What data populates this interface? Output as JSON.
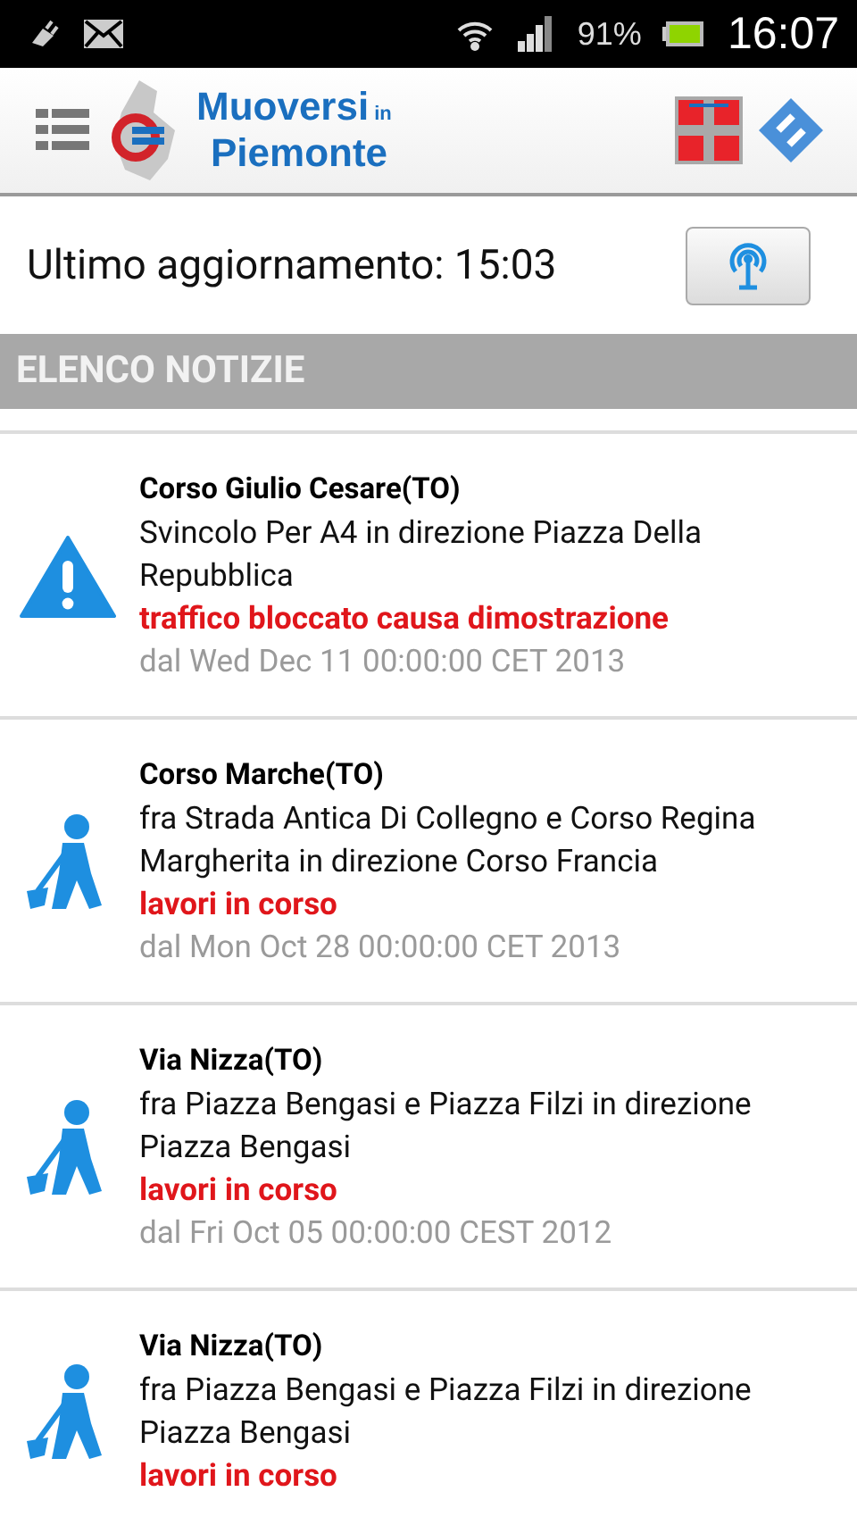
{
  "status_bar": {
    "battery": "91%",
    "time": "16:07"
  },
  "header": {
    "logo_line1": "Muoversi",
    "logo_small": "in",
    "logo_line2": "Piemonte"
  },
  "update": {
    "label": "Ultimo aggiornamento: 15:03"
  },
  "section": {
    "title": "ELENCO NOTIZIE"
  },
  "news": [
    {
      "kind": "warning",
      "title": "Corso Giulio Cesare(TO)",
      "description": "Svincolo Per A4 in direzione Piazza Della Repubblica",
      "cause": "traffico bloccato causa dimostrazione",
      "date": "dal Wed Dec 11 00:00:00 CET 2013"
    },
    {
      "kind": "roadwork",
      "title": "Corso Marche(TO)",
      "description": "fra Strada Antica Di Collegno e Corso Regina Margherita in direzione Corso Francia",
      "cause": "lavori in corso",
      "date": "dal Mon Oct 28 00:00:00 CET 2013"
    },
    {
      "kind": "roadwork",
      "title": "Via Nizza(TO)",
      "description": "fra Piazza Bengasi e Piazza Filzi in direzione Piazza Bengasi",
      "cause": "lavori in corso",
      "date": "dal Fri Oct 05 00:00:00 CEST 2012"
    },
    {
      "kind": "roadwork",
      "title": "Via Nizza(TO)",
      "description": "fra Piazza Bengasi e Piazza Filzi in direzione Piazza Bengasi",
      "cause": "lavori in corso"
    }
  ]
}
